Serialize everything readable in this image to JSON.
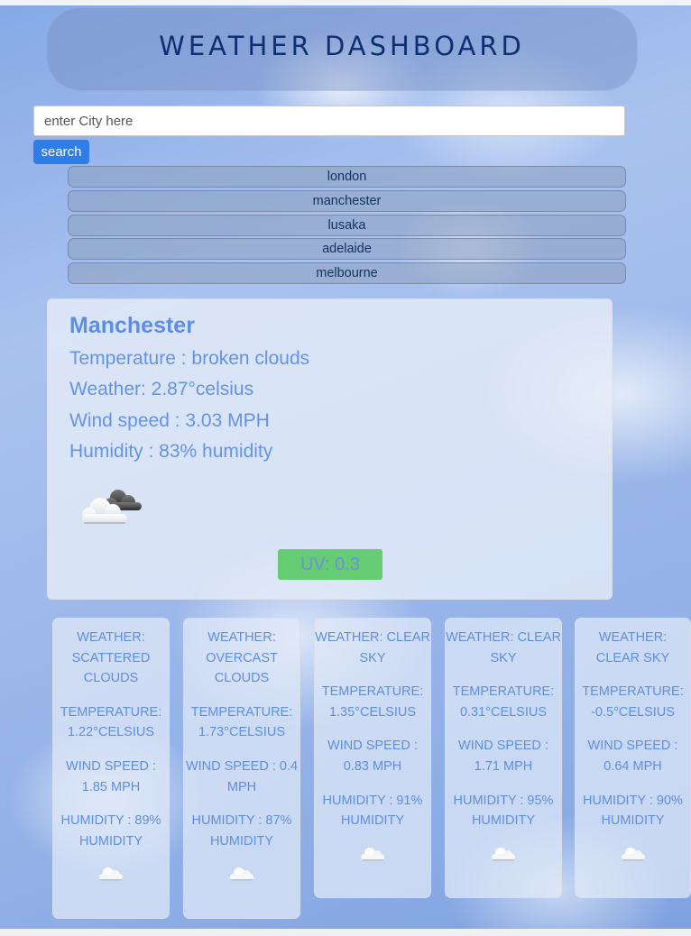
{
  "header": {
    "title": "WEATHER DASHBOARD"
  },
  "search": {
    "placeholder": "enter City here",
    "value": "",
    "button_label": "search"
  },
  "history": [
    {
      "label": "london"
    },
    {
      "label": "manchester"
    },
    {
      "label": "lusaka"
    },
    {
      "label": "adelaide"
    },
    {
      "label": "melbourne"
    }
  ],
  "current": {
    "city": "Manchester",
    "temperature_line": "Temperature : broken clouds",
    "weather_line": "Weather: 2.87°celsius",
    "wind_line": "Wind speed : 3.03 MPH",
    "humidity_line": "Humidity : 83% humidity",
    "icon": "broken-clouds-icon",
    "uv_label": "UV: 0.3"
  },
  "forecast": [
    {
      "weather": "Weather: scattered clouds",
      "temperature": "Temperature: 1.22°celsius",
      "wind": "Wind speed : 1.85 MPH",
      "humidity": "Humidity : 89% humidity",
      "icon": "cloud-icon"
    },
    {
      "weather": "Weather: overcast clouds",
      "temperature": "Temperature: 1.73°celsius",
      "wind": "Wind speed : 0.4 MPH",
      "humidity": "Humidity : 87% humidity",
      "icon": "cloud-icon"
    },
    {
      "weather": "Weather: clear sky",
      "temperature": "Temperature: 1.35°celsius",
      "wind": "Wind speed : 0.83 MPH",
      "humidity": "Humidity : 91% humidity",
      "icon": "cloud-icon"
    },
    {
      "weather": "Weather: clear sky",
      "temperature": "Temperature: 0.31°celsius",
      "wind": "Wind speed : 1.71 MPH",
      "humidity": "Humidity : 95% humidity",
      "icon": "cloud-icon"
    },
    {
      "weather": "Weather: clear sky",
      "temperature": "Temperature: -0.5°celsius",
      "wind": "Wind speed : 0.64 MPH",
      "humidity": "Humidity : 90% humidity",
      "icon": "cloud-icon"
    }
  ],
  "colors": {
    "header_text": "#0f2f73",
    "button": "#2f7de8",
    "accent_text": "#5e8fe0",
    "uv_badge": "#66cc73"
  }
}
